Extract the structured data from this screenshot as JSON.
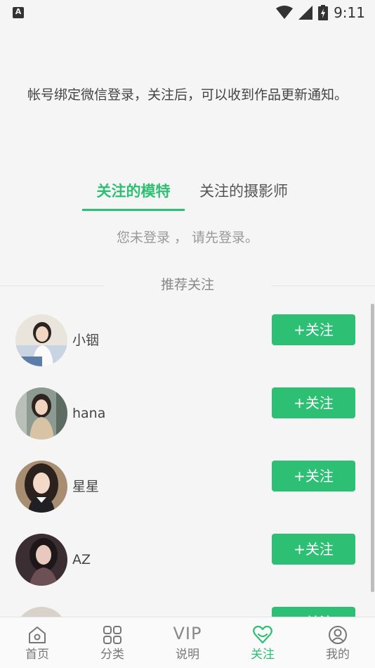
{
  "status_bar": {
    "time": "9:11",
    "app_icon_letter": "A"
  },
  "notice": "帐号绑定微信登录，关注后，可以收到作品更新通知。",
  "tabs": [
    {
      "label": "关注的模特",
      "active": true
    },
    {
      "label": "关注的摄影师",
      "active": false
    }
  ],
  "login_hint": "您未登录 ， 请先登录。",
  "recommend": {
    "title": "推荐关注",
    "items": [
      {
        "name": "小铟",
        "button": "+关注"
      },
      {
        "name": "hana",
        "button": "+关注"
      },
      {
        "name": "星星",
        "button": "+关注"
      },
      {
        "name": "AZ",
        "button": "+关注"
      },
      {
        "name": "",
        "button": "+关注"
      }
    ]
  },
  "bottom_nav": [
    {
      "label": "首页",
      "icon": "home-icon"
    },
    {
      "label": "分类",
      "icon": "grid-icon"
    },
    {
      "label": "说明",
      "icon": "vip-icon",
      "icon_text": "VIP"
    },
    {
      "label": "关注",
      "icon": "heart-icon",
      "active": true
    },
    {
      "label": "我的",
      "icon": "user-icon"
    }
  ],
  "colors": {
    "accent": "#2dbf73",
    "background": "#f5f5f5"
  }
}
